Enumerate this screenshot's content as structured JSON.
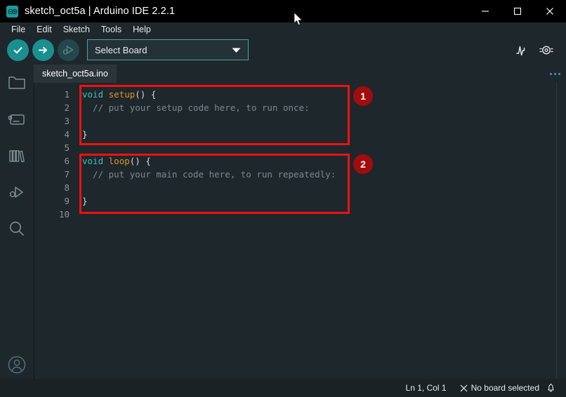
{
  "window": {
    "title": "sketch_oct5a | Arduino IDE 2.2.1",
    "logo_name": "arduino-logo-icon",
    "controls": {
      "minimize": "minimize-button",
      "maximize": "maximize-button",
      "close": "close-button"
    }
  },
  "menubar": {
    "items": [
      {
        "label": "File"
      },
      {
        "label": "Edit"
      },
      {
        "label": "Sketch"
      },
      {
        "label": "Tools"
      },
      {
        "label": "Help"
      }
    ]
  },
  "toolbar": {
    "verify_label": "Verify",
    "upload_label": "Upload",
    "debug_label": "Debug",
    "board_select": {
      "value": "Select Board",
      "placeholder": "Select Board"
    },
    "serial_plotter_label": "Serial Plotter",
    "serial_monitor_label": "Serial Monitor"
  },
  "sidebar": {
    "items": [
      {
        "name": "sketchbook",
        "label": "Sketchbook"
      },
      {
        "name": "boards-manager",
        "label": "Boards Manager"
      },
      {
        "name": "library-manager",
        "label": "Library Manager"
      },
      {
        "name": "debug",
        "label": "Debug"
      },
      {
        "name": "search",
        "label": "Search"
      }
    ],
    "account": {
      "name": "account",
      "label": "Arduino Cloud Account"
    }
  },
  "tabs": [
    {
      "label": "sketch_oct5a.ino",
      "active": true
    }
  ],
  "editor": {
    "line_numbers": [
      "1",
      "2",
      "3",
      "4",
      "5",
      "6",
      "7",
      "8",
      "9",
      "10"
    ],
    "lines": [
      {
        "n": 1,
        "tokens": [
          {
            "text": "void",
            "type": "kw"
          },
          {
            "text": " ",
            "type": "pun"
          },
          {
            "text": "setup",
            "type": "fn"
          },
          {
            "text": "() {",
            "type": "pun"
          }
        ]
      },
      {
        "n": 2,
        "tokens": [
          {
            "text": "  // put your setup code here, to run once:",
            "type": "com"
          }
        ]
      },
      {
        "n": 3,
        "tokens": []
      },
      {
        "n": 4,
        "tokens": [
          {
            "text": "}",
            "type": "pun"
          }
        ]
      },
      {
        "n": 5,
        "tokens": []
      },
      {
        "n": 6,
        "tokens": [
          {
            "text": "void",
            "type": "kw"
          },
          {
            "text": " ",
            "type": "pun"
          },
          {
            "text": "loop",
            "type": "fn"
          },
          {
            "text": "() {",
            "type": "pun"
          }
        ]
      },
      {
        "n": 7,
        "tokens": [
          {
            "text": "  // put your main code here, to run repeatedly:",
            "type": "com"
          }
        ]
      },
      {
        "n": 8,
        "tokens": []
      },
      {
        "n": 9,
        "tokens": [
          {
            "text": "}",
            "type": "pun"
          }
        ]
      },
      {
        "n": 10,
        "tokens": []
      }
    ]
  },
  "annotations": [
    {
      "badge": "1",
      "target": "setup-function-block"
    },
    {
      "badge": "2",
      "target": "loop-function-block"
    }
  ],
  "statusbar": {
    "cursor_position": "Ln 1, Col 1",
    "board_status": "No board selected",
    "board_status_icon": "close-x-icon",
    "notifications_icon": "bell-icon"
  },
  "colors": {
    "accent_teal": "#1a8f8f",
    "annotation_red": "#ee1111",
    "badge_red": "#a30c0c",
    "editor_bg": "#1e272c",
    "titlebar_bg": "#000000",
    "statusbar_bg": "#1a2226",
    "keyword": "#39c0c0",
    "function": "#e0922a",
    "comment": "#7b8791"
  }
}
